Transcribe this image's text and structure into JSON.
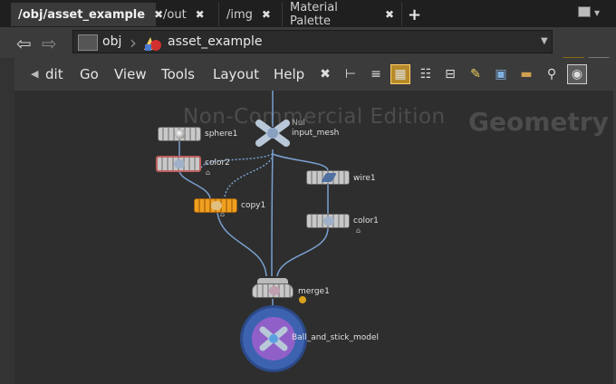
{
  "tabs": [
    {
      "label": "/obj/asset_example",
      "active": true
    },
    {
      "label": "/out",
      "active": false
    },
    {
      "label": "/img",
      "active": false
    },
    {
      "label": "Material Palette",
      "active": false
    }
  ],
  "tab_close_glyph": "✖",
  "new_tab_glyph": "+",
  "path": {
    "root": "obj",
    "node": "asset_example"
  },
  "menu": {
    "partial_first": "dit",
    "items": [
      "Go",
      "View",
      "Tools",
      "Layout",
      "Help"
    ]
  },
  "toolbar_icons": [
    "wrench-icon",
    "tree-icon",
    "list-icon",
    "grid-icon",
    "details-icon",
    "split-icon",
    "note-icon",
    "image-icon",
    "box-icon",
    "search-icon",
    "eye-icon"
  ],
  "watermark": "Non-Commercial Edition",
  "context_label": "Geometry",
  "nodes": {
    "sphere1": "sphere1",
    "input_mesh": "input_mesh",
    "input_mesh_tag": "Nul",
    "color2": "color2",
    "copy1": "copy1",
    "wire1": "wire1",
    "color1": "color1",
    "merge1": "merge1",
    "output": "Ball_and_stick_model"
  },
  "colors": {
    "accent": "#d8a21c",
    "copy_node": "#f0a020",
    "output_ring": "#4a74c8",
    "output_fill": "#8a5ac8",
    "wire": "#7aa0d0"
  }
}
